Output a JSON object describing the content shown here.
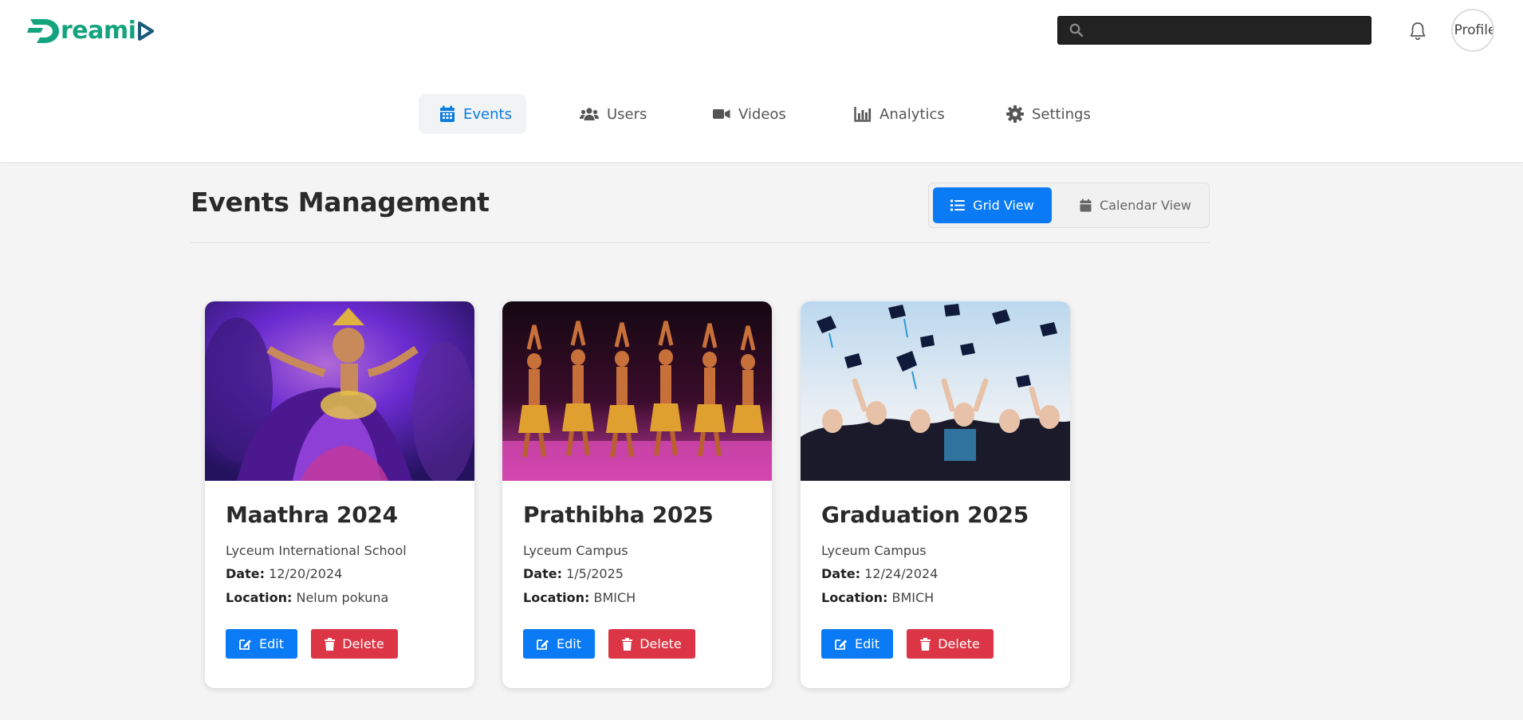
{
  "header": {
    "logo_text": "reami",
    "search_placeholder": "",
    "avatar_alt": "Profile"
  },
  "nav": {
    "items": [
      {
        "label": "Events",
        "icon": "calendar-icon",
        "active": true
      },
      {
        "label": "Users",
        "icon": "users-icon",
        "active": false
      },
      {
        "label": "Videos",
        "icon": "video-icon",
        "active": false
      },
      {
        "label": "Analytics",
        "icon": "chart-bar-icon",
        "active": false
      },
      {
        "label": "Settings",
        "icon": "gear-icon",
        "active": false
      }
    ]
  },
  "main": {
    "title": "Events Management",
    "view_toggle": {
      "grid_label": "Grid View",
      "calendar_label": "Calendar View",
      "selected": "Grid View"
    },
    "events": [
      {
        "title": "Maathra 2024",
        "venue": "Lyceum International School",
        "date_label": "Date:",
        "date": "12/20/2024",
        "location_label": "Location:",
        "location": "Nelum pokuna",
        "edit_label": "Edit",
        "delete_label": "Delete"
      },
      {
        "title": "Prathibha 2025",
        "venue": "Lyceum Campus",
        "date_label": "Date:",
        "date": "1/5/2025",
        "location_label": "Location:",
        "location": "BMICH",
        "edit_label": "Edit",
        "delete_label": "Delete"
      },
      {
        "title": "Graduation 2025",
        "venue": "Lyceum Campus",
        "date_label": "Date:",
        "date": "12/24/2024",
        "location_label": "Location:",
        "location": "BMICH",
        "edit_label": "Edit",
        "delete_label": "Delete"
      }
    ]
  },
  "colors": {
    "brand": "#14a37f",
    "primary": "#0a7bf5",
    "danger": "#dc3545",
    "active_nav": "#0a7bde"
  }
}
